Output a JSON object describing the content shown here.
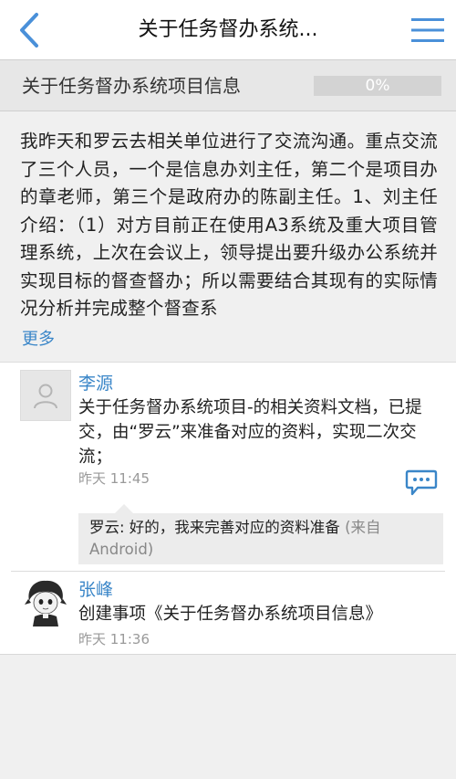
{
  "header": {
    "title": "关于任务督办系统...",
    "back_icon": "chevron-left-icon",
    "menu_icon": "hamburger-menu-icon",
    "accent_color": "#4a90d9"
  },
  "project": {
    "title": "关于任务督办系统项目信息",
    "progress_label": "0%",
    "progress_fraction": 0
  },
  "description": {
    "text": "我昨天和罗云去相关单位进行了交流沟通。重点交流了三个人员，一个是信息办刘主任，第二个是项目办的章老师，第三个是政府办的陈副主任。1、刘主任介绍：（1）对方目前正在使用A3系统及重大项目管理系统，上次在会议上，领导提出要升级办公系统并实现目标的督查督办；所以需要结合其现有的实际情况分析并完成整个督查系",
    "more_label": "更多"
  },
  "feed": {
    "items": [
      {
        "author": "李源",
        "content": "关于任务督办系统项目-的相关资料文档，已提交，由“罗云”来准备对应的资料，实现二次交流；",
        "time": "昨天 11:45",
        "avatar_icon": "default-user-icon",
        "comment_icon": "comment-bubble-icon",
        "reply": {
          "text": "罗云: 好的，我来完善对应的资料准备",
          "source": "(来自Android)"
        }
      },
      {
        "author": "张峰",
        "content": "创建事项《关于任务督办系统项目信息》",
        "time": "昨天 11:36",
        "avatar_icon": "cartoon-avatar-icon"
      }
    ]
  }
}
